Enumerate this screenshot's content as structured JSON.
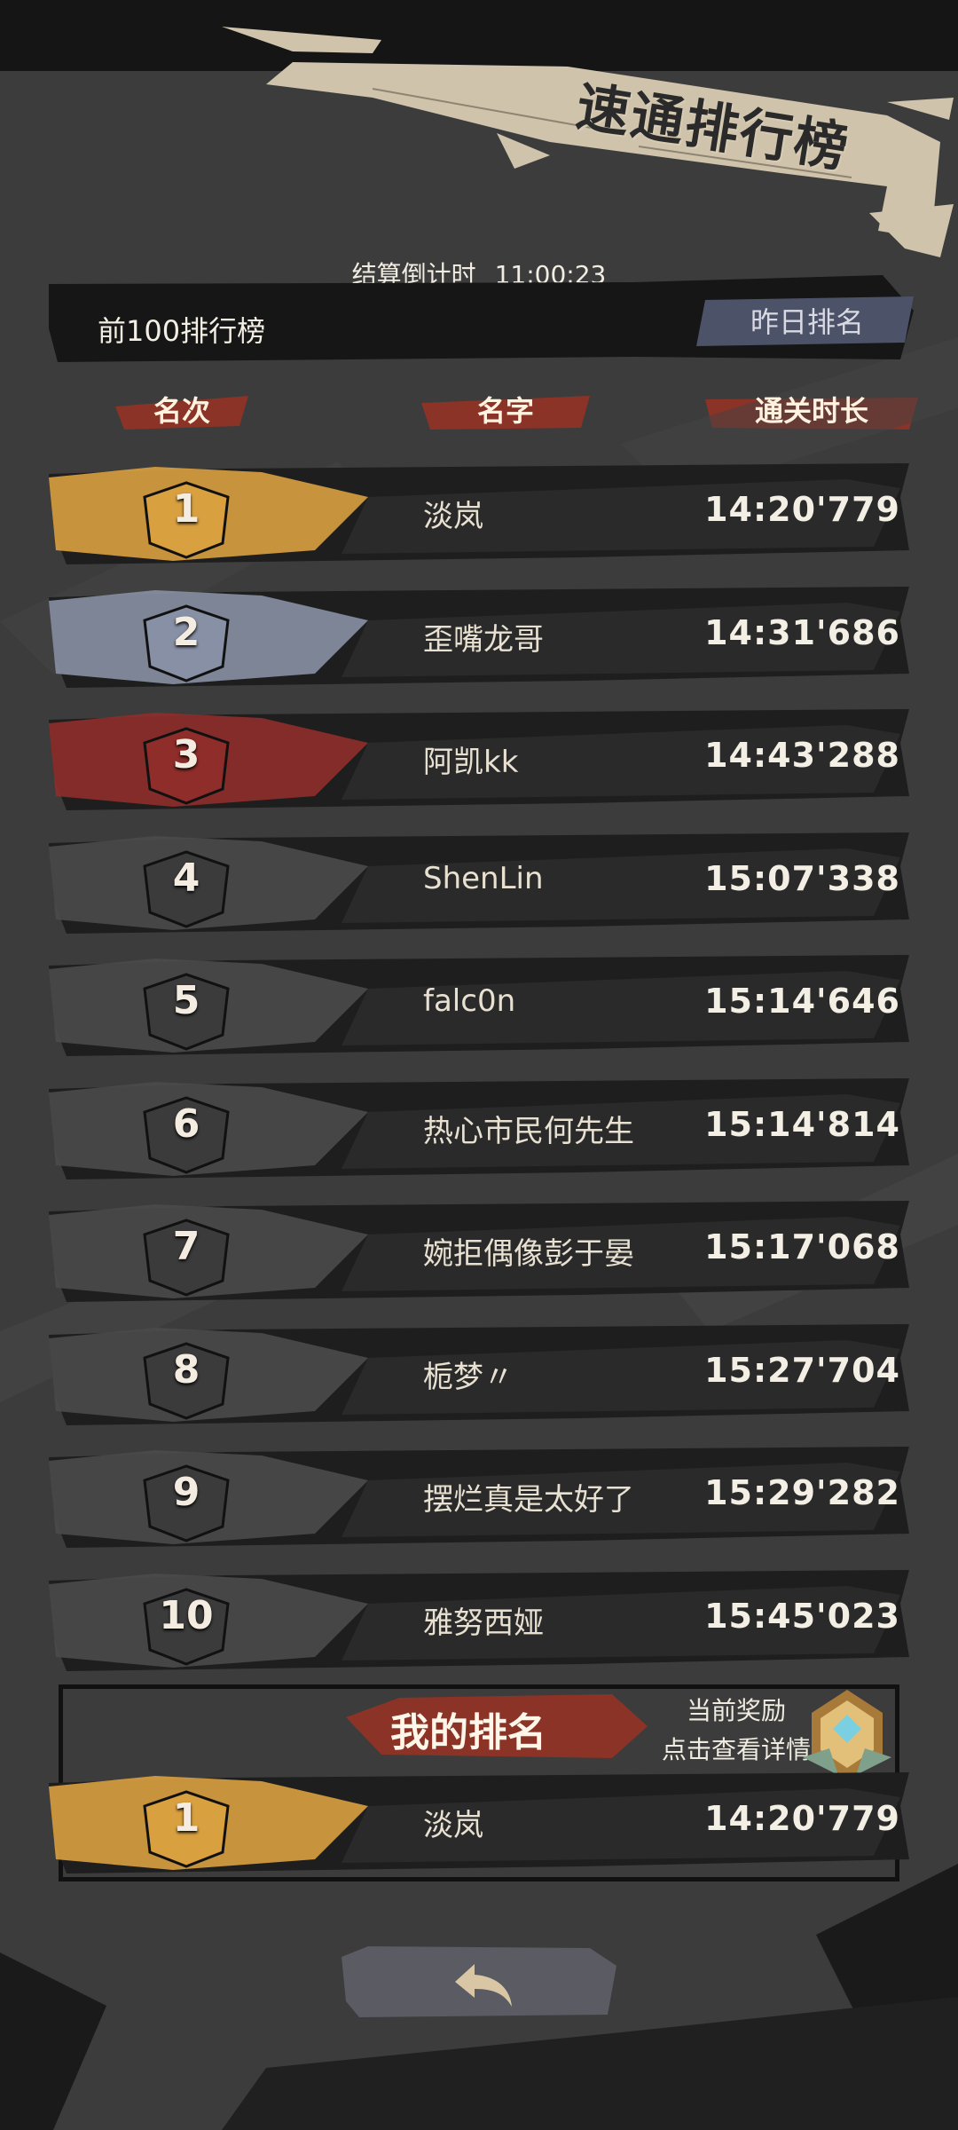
{
  "header": {
    "title": "速通排行榜"
  },
  "countdown": {
    "label": "结算倒计时",
    "time": "11:00:23"
  },
  "board": {
    "label": "前100排行榜",
    "yesterday_button": "昨日排名"
  },
  "columns": {
    "rank": "名次",
    "name": "名字",
    "time": "通关时长"
  },
  "rows": [
    {
      "rank": "1",
      "name": "淡岚",
      "time": "14:20'779",
      "tier": "gold"
    },
    {
      "rank": "2",
      "name": "歪嘴龙哥",
      "time": "14:31'686",
      "tier": "silver"
    },
    {
      "rank": "3",
      "name": "阿凯kk",
      "time": "14:43'288",
      "tier": "bronze"
    },
    {
      "rank": "4",
      "name": "ShenLin",
      "time": "15:07'338",
      "tier": "normal"
    },
    {
      "rank": "5",
      "name": "falc0n",
      "time": "15:14'646",
      "tier": "normal"
    },
    {
      "rank": "6",
      "name": "热心市民何先生",
      "time": "15:14'814",
      "tier": "normal"
    },
    {
      "rank": "7",
      "name": "婉拒偶像彭于晏",
      "time": "15:17'068",
      "tier": "normal"
    },
    {
      "rank": "8",
      "name": "栀梦〃",
      "time": "15:27'704",
      "tier": "normal"
    },
    {
      "rank": "9",
      "name": "摆烂真是太好了",
      "time": "15:29'282",
      "tier": "normal"
    },
    {
      "rank": "10",
      "name": "雅努西娅",
      "time": "15:45'023",
      "tier": "normal"
    }
  ],
  "my_rank": {
    "title": "我的排名",
    "reward_line1": "当前奖励",
    "reward_line2": "点击查看详情",
    "row": {
      "rank": "1",
      "name": "淡岚",
      "time": "14:20'779",
      "tier": "gold"
    }
  },
  "icons": {
    "back": "back-arrow-icon",
    "reward": "reward-medal-icon",
    "rank_badge": "rank-badge-icon"
  },
  "colors": {
    "gold": "#d9a040",
    "silver": "#8790a4",
    "bronze": "#8e2d2a",
    "normal": "#4a4a4a",
    "brush_red": "#9a3a2c",
    "title_paper": "#cfc3ac"
  }
}
